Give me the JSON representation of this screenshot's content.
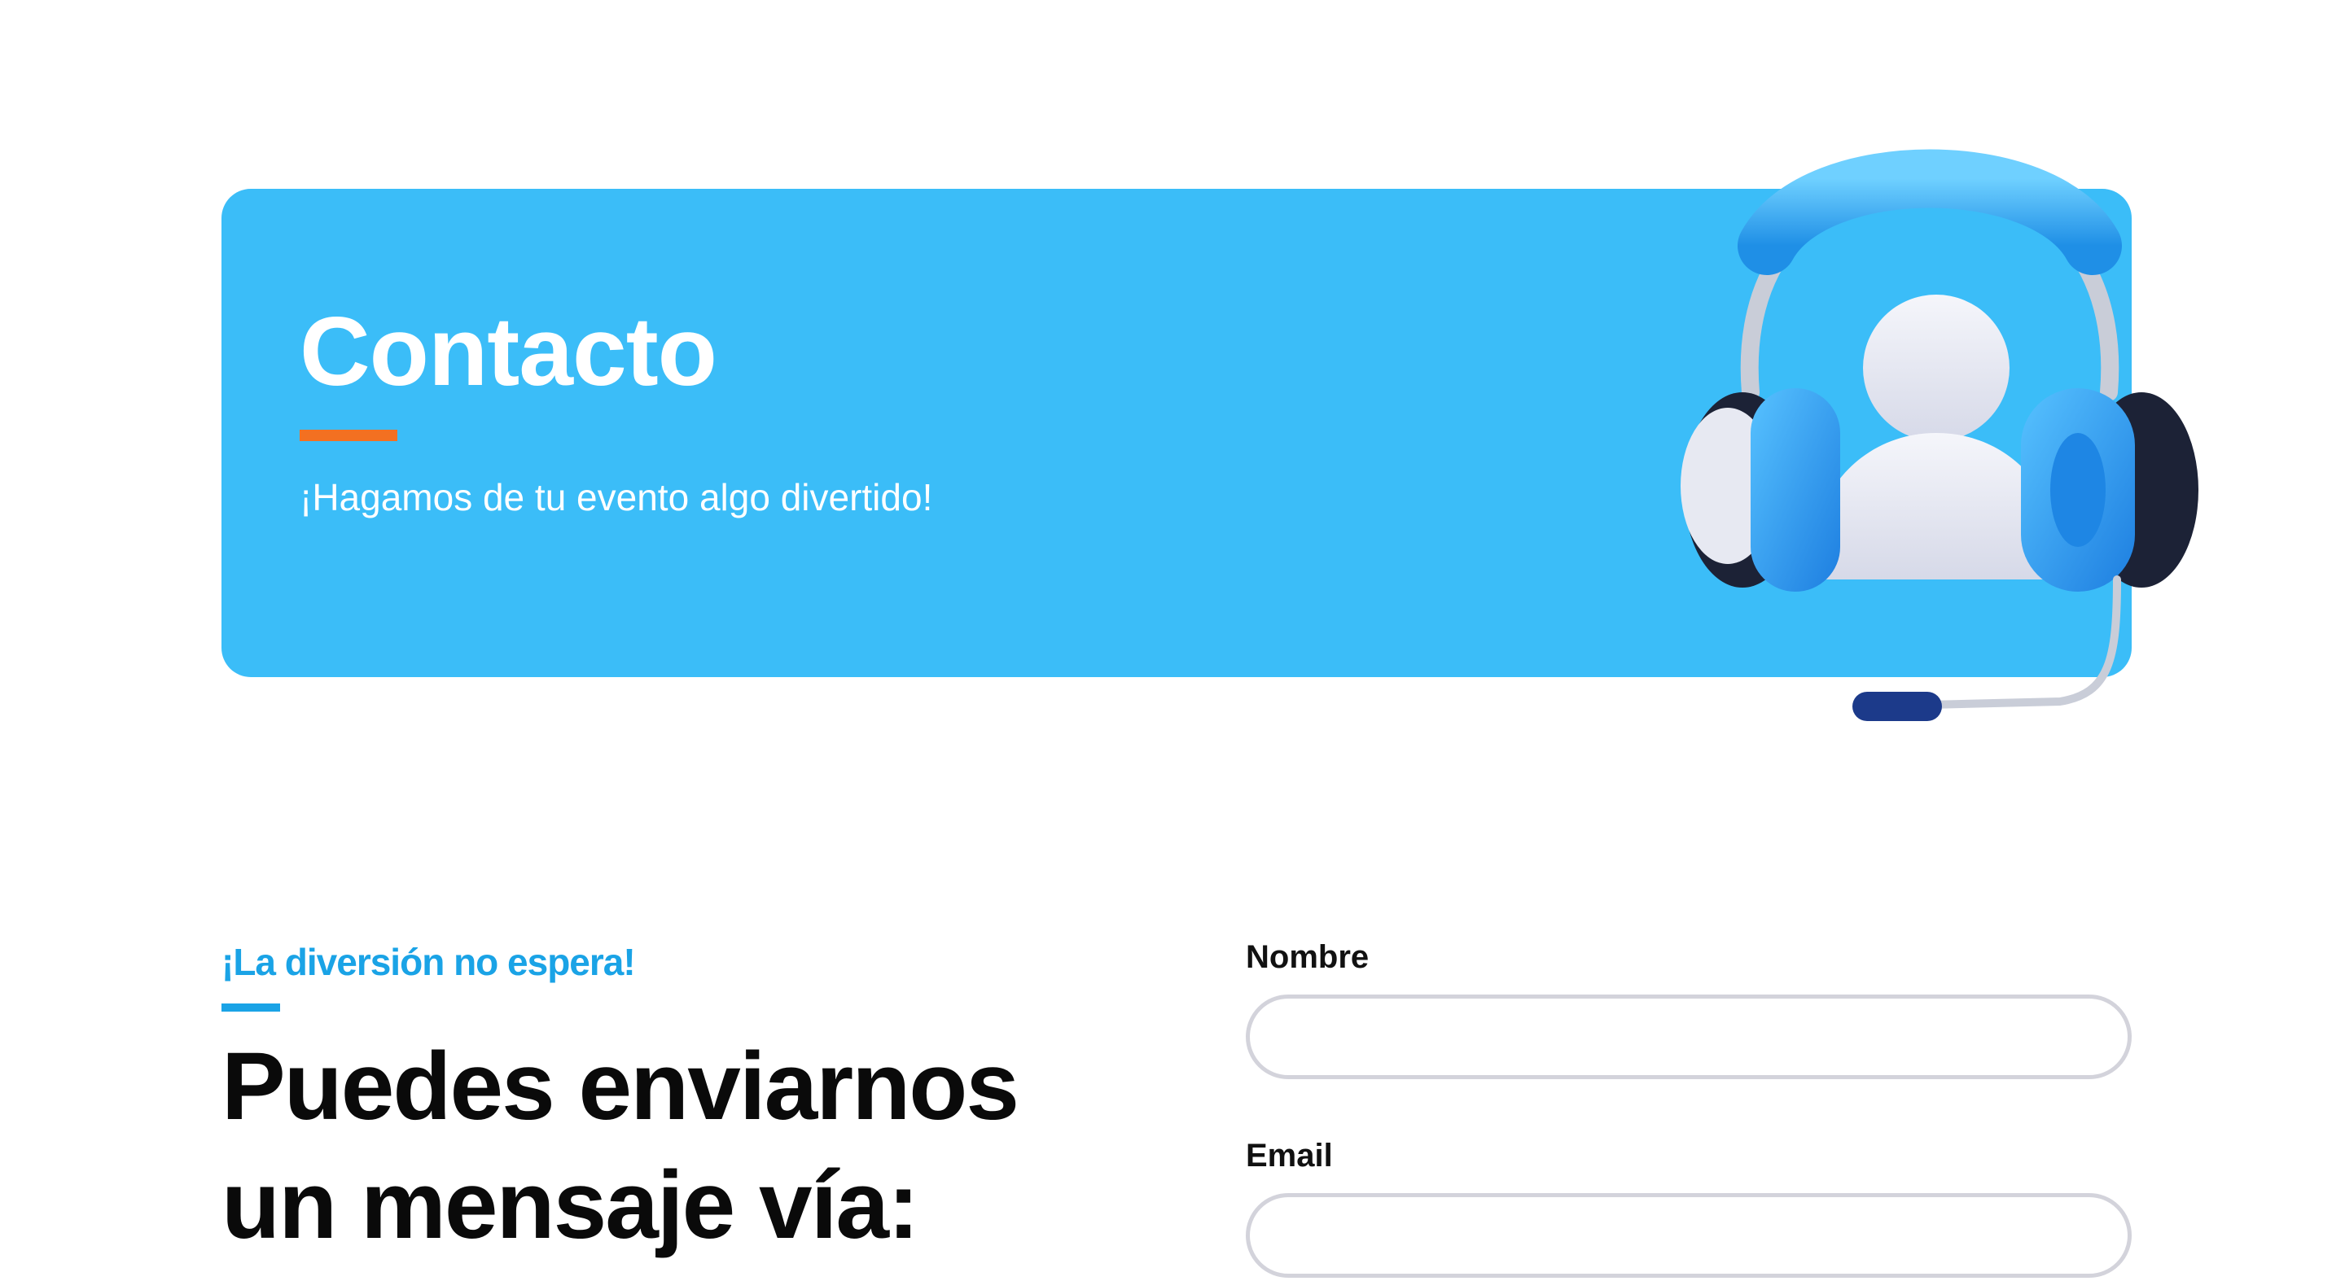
{
  "hero": {
    "title": "Contacto",
    "subtitle": "¡Hagamos de tu evento algo divertido!",
    "illustration_icon": "headset-user-icon"
  },
  "contact_section": {
    "eyebrow": "¡La diversión no espera!",
    "title": "Puedes enviarnos un mensaje vía:"
  },
  "form": {
    "name_label": "Nombre",
    "name_value": "",
    "email_label": "Email",
    "email_value": ""
  },
  "colors": {
    "hero_background": "#3bbdf8",
    "accent_orange": "#f37021",
    "accent_blue": "#1aa3e6",
    "input_border": "#d3d3db"
  }
}
